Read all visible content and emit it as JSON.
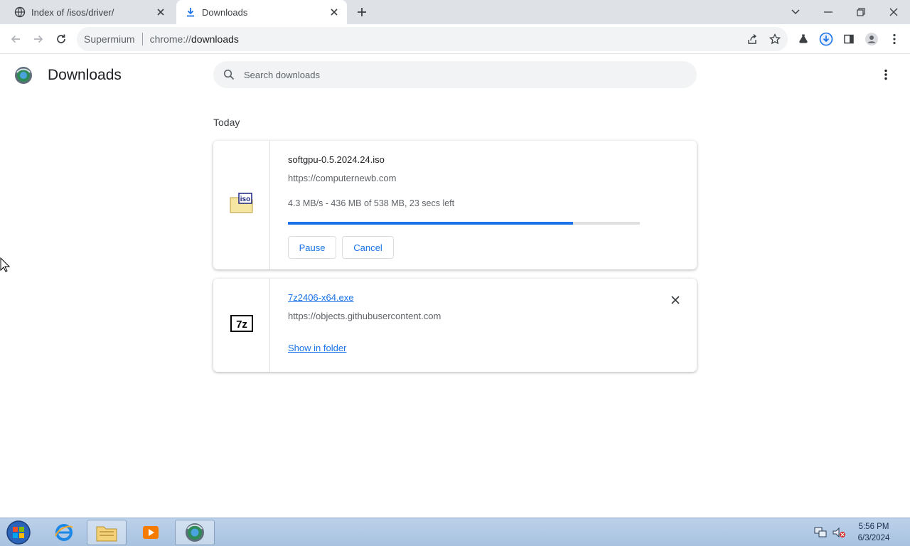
{
  "tabs": [
    {
      "title": "Index of /isos/driver/",
      "icon": "globe-icon",
      "active": false
    },
    {
      "title": "Downloads",
      "icon": "download-icon",
      "active": true
    }
  ],
  "omnibox": {
    "origin": "Supermium",
    "url_scheme": "chrome://",
    "url_host": "downloads"
  },
  "page": {
    "title": "Downloads",
    "search_placeholder": "Search downloads",
    "section_label": "Today"
  },
  "downloads": [
    {
      "filename": "softgpu-0.5.2024.24.iso",
      "source": "https://computernewb.com",
      "status": "4.3 MB/s - 436 MB of 538 MB, 23 secs left",
      "progress_fraction": 0.81,
      "pause_label": "Pause",
      "cancel_label": "Cancel",
      "file_icon": "iso-file-icon"
    },
    {
      "filename": "7z2406-x64.exe",
      "source": "https://objects.githubusercontent.com",
      "show_in_folder_label": "Show in folder",
      "file_icon": "7zip-file-icon"
    }
  ],
  "taskbar": {
    "time": "5:56 PM",
    "date": "6/3/2024"
  },
  "colors": {
    "accent": "#1a73e8",
    "tabstrip": "#dee1e6",
    "omnibox": "#f1f3f4"
  }
}
